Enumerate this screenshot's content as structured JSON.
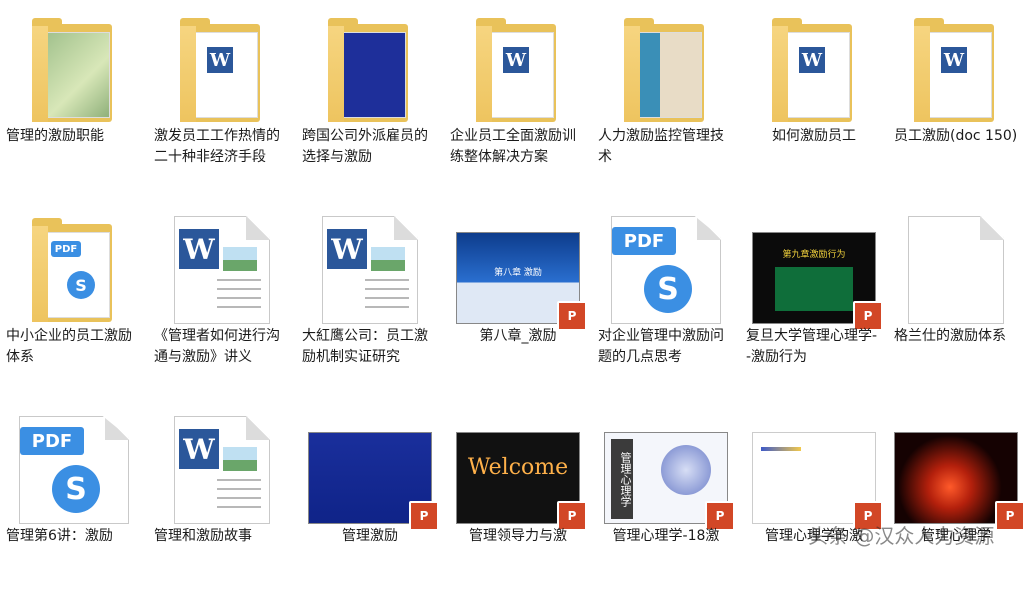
{
  "items": [
    {
      "label": "管理的激励职能",
      "icon": "folder-icon"
    },
    {
      "label": "激发员工工作热情的二十种非经济手段",
      "icon": "folder-icon"
    },
    {
      "label": "跨国公司外派雇员的选择与激励",
      "icon": "folder-icon"
    },
    {
      "label": "企业员工全面激励训练整体解决方案",
      "icon": "folder-icon"
    },
    {
      "label": "人力激励监控管理技术",
      "icon": "folder-icon"
    },
    {
      "label": "如何激励员工",
      "icon": "folder-icon"
    },
    {
      "label": "员工激励(doc 150)",
      "icon": "folder-icon"
    },
    {
      "label": "中小企业的员工激励体系",
      "icon": "folder-icon"
    },
    {
      "label": "《管理者如何进行沟通与激励》讲义",
      "icon": "word-document-icon"
    },
    {
      "label": "大紅鹰公司：员工激励机制实证研究",
      "icon": "word-document-icon"
    },
    {
      "label": "第八章_激励",
      "icon": "powerpoint-icon",
      "slide_title": "第八章  激励"
    },
    {
      "label": "对企业管理中激励问题的几点思考",
      "icon": "pdf-icon"
    },
    {
      "label": "复旦大学管理心理学--激励行为",
      "icon": "powerpoint-icon",
      "slide_title": "第九章激励行为"
    },
    {
      "label": "格兰仕的激励体系",
      "icon": "blank-file-icon"
    },
    {
      "label": "管理第6讲：激励",
      "icon": "pdf-icon"
    },
    {
      "label": "管理和激励故事",
      "icon": "word-document-icon"
    },
    {
      "label": "管理激励",
      "icon": "powerpoint-icon"
    },
    {
      "label": "管理领导力与激",
      "icon": "powerpoint-icon",
      "slide_title": "Welcome"
    },
    {
      "label": "管理心理学-18激",
      "icon": "powerpoint-icon",
      "slide_title": "管理心理学"
    },
    {
      "label": "管理心理学的激",
      "icon": "powerpoint-icon"
    },
    {
      "label": "管理心理学",
      "icon": "powerpoint-icon"
    }
  ],
  "badges": {
    "pdf": "PDF",
    "word": "W",
    "ppt": "P"
  },
  "watermark": "头条 @汉众人力资源"
}
